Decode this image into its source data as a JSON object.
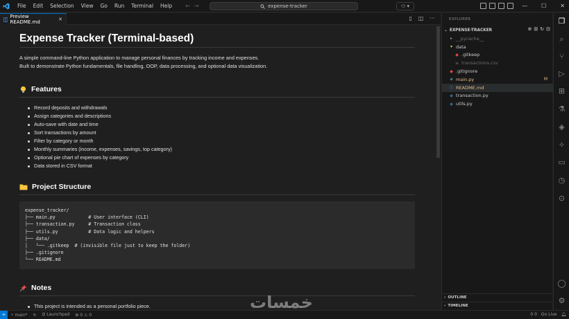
{
  "titlebar": {
    "menu": [
      "File",
      "Edit",
      "Selection",
      "View",
      "Go",
      "Run",
      "Terminal",
      "Help"
    ],
    "search_text": "expense-tracker"
  },
  "editor": {
    "tab_label": "Preview README.md"
  },
  "readme": {
    "title": "Expense Tracker (Terminal-based)",
    "intro_1": "A simple command-line Python application to manage personal finances by tracking income and expenses.",
    "intro_2": "Built to demonstrate Python fundamentals, file handling, OOP, data processing, and optional data visualization.",
    "features_heading": "Features",
    "features": [
      "Record deposits and withdrawals",
      "Assign categories and descriptions",
      "Auto-save with date and time",
      "Sort transactions by amount",
      "Filter by category or month",
      "Monthly summaries (income, expenses, savings, top category)",
      "Optional pie chart of expenses by category",
      "Data stored in CSV format"
    ],
    "structure_heading": "Project Structure",
    "structure_code": "expense_tracker/\n├── main.py            # User interface (CLI)\n├── transaction.py     # Transaction class\n├── utils.py           # Data logic and helpers\n├── data/\n│   └── .gitkeep  # (invisible file just to keep the folder)\n├── .gitignore\n└── README.md",
    "notes_heading": "Notes",
    "notes": [
      "This project is intended as a personal portfolio piece."
    ]
  },
  "explorer": {
    "title": "EXPLORER",
    "root": "EXPENSE-TRACKER",
    "items": [
      {
        "label": "__pycache__",
        "color": "#6e6e6e",
        "icon": "folder-icon",
        "indent": 1
      },
      {
        "label": "data",
        "color": "#cccccc",
        "icon": "folder-open-icon",
        "indent": 1
      },
      {
        "label": ".gitkeep",
        "color": "#cccccc",
        "icon": "git-icon",
        "indent": 2
      },
      {
        "label": "transactions.csv",
        "color": "#6e6e6e",
        "icon": "csv-icon",
        "indent": 2
      },
      {
        "label": ".gitignore",
        "color": "#cccccc",
        "icon": "git-icon",
        "indent": 1
      },
      {
        "label": "main.py",
        "color": "#e2c08d",
        "icon": "python-icon",
        "indent": 1,
        "badge": "M"
      },
      {
        "label": "README.md",
        "color": "#e2c08d",
        "icon": "info-icon",
        "indent": 1
      },
      {
        "label": "transaction.py",
        "color": "#cccccc",
        "icon": "python-icon",
        "indent": 1
      },
      {
        "label": "utils.py",
        "color": "#cccccc",
        "icon": "python-icon",
        "indent": 1
      }
    ],
    "outline": "OUTLINE",
    "timeline": "TIMELINE"
  },
  "statusbar": {
    "branch": "main*",
    "launchpad": "Launchpad",
    "problems": "0 ⚠ 0",
    "right_items": [
      "0 0",
      "Go Live"
    ]
  },
  "watermark": "خمسات"
}
